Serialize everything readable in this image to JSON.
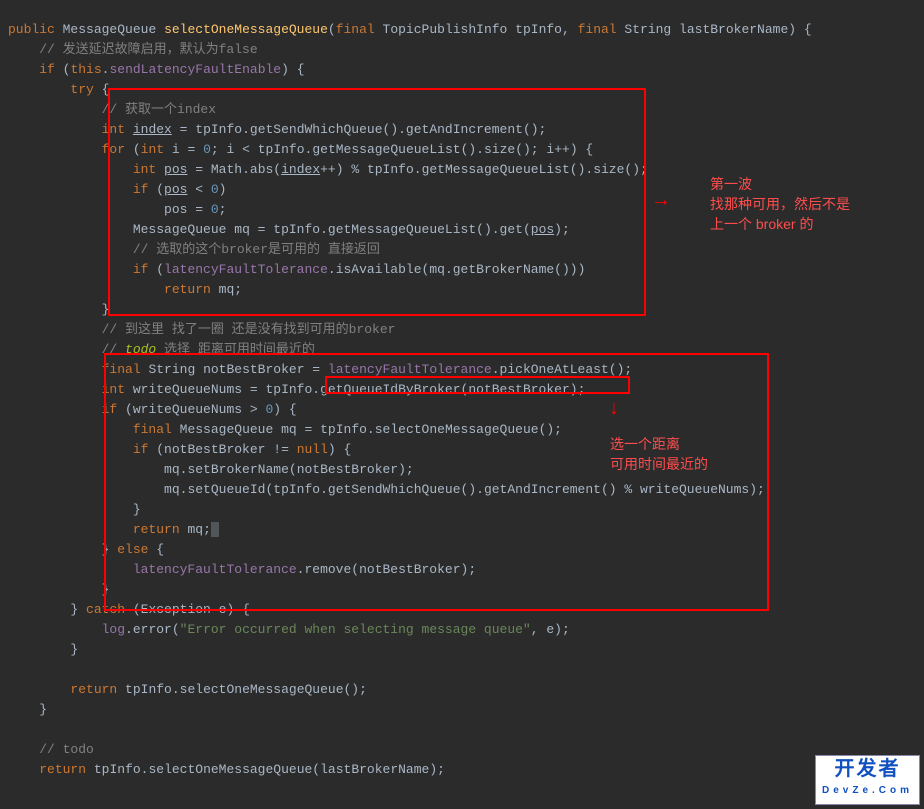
{
  "code": {
    "l0a": "public",
    "l0b": "MessageQueue",
    "l0c": "selectOneMessageQueue",
    "l0d": "final",
    "l0e": "TopicPublishInfo",
    "l0f": "tpInfo",
    "l0g": "final",
    "l0h": "String",
    "l0i": "lastBrokerName",
    "c1": "// 发送延迟故障启用，默认为false",
    "l2a": "if",
    "l2b": "this",
    "l2c": "sendLatencyFaultEnable",
    "l3a": "try",
    "c4": "// 获取一个index",
    "l5a": "int",
    "l5b": "index",
    "l5c": "tpInfo",
    "l5d": "getSendWhichQueue",
    "l5e": "getAndIncrement",
    "l6a": "for",
    "l6b": "int",
    "l6c": "i",
    "l6d": "0",
    "l6e": "i",
    "l6f": "tpInfo",
    "l6g": "getMessageQueueList",
    "l6h": "size",
    "l6i": "i++",
    "l7a": "int",
    "l7b": "pos",
    "l7c": "Math",
    "l7d": "abs",
    "l7e": "index",
    "l7f": "tpInfo",
    "l7g": "getMessageQueueList",
    "l7h": "size",
    "l8a": "if",
    "l8b": "pos",
    "l8c": "0",
    "l9a": "pos",
    "l9b": "0",
    "l10a": "MessageQueue",
    "l10b": "mq",
    "l10c": "tpInfo",
    "l10d": "getMessageQueueList",
    "l10e": "get",
    "l10f": "pos",
    "c11": "// 选取的这个broker是可用的 直接返回",
    "l12a": "if",
    "l12b": "latencyFaultTolerance",
    "l12c": "isAvailable",
    "l12d": "mq",
    "l12e": "getBrokerName",
    "l13a": "return",
    "l13b": "mq",
    "c15": "// 到这里 找了一圈 还是没有找到可用的broker",
    "c16a": "// ",
    "c16b": "todo",
    "c16c": " 选择 距离可用时间最近的",
    "l17a": "final",
    "l17b": "String",
    "l17c": "notBestBroker",
    "l17d": "latencyFaultTolerance",
    "l17e": "pickOneAtLeast",
    "l18a": "int",
    "l18b": "writeQueueNums",
    "l18c": "tpInfo",
    "l18d": "getQueueIdByBroker",
    "l18e": "notBestBroker",
    "l19a": "if",
    "l19b": "writeQueueNums",
    "l19c": "0",
    "l20a": "final",
    "l20b": "MessageQueue",
    "l20c": "mq",
    "l20d": "tpInfo",
    "l20e": "selectOneMessageQueue",
    "l21a": "if",
    "l21b": "notBestBroker",
    "l21c": "null",
    "l22a": "mq",
    "l22b": "setBrokerName",
    "l22c": "notBestBroker",
    "l23a": "mq",
    "l23b": "setQueueId",
    "l23c": "tpInfo",
    "l23d": "getSendWhichQueue",
    "l23e": "getAndIncrement",
    "l23f": "writeQueueNums",
    "l25a": "return",
    "l25b": "mq",
    "l26a": "else",
    "l27a": "latencyFaultTolerance",
    "l27b": "remove",
    "l27c": "notBestBroker",
    "l29a": "catch",
    "l29b": "Exception",
    "l29c": "e",
    "l30a": "log",
    "l30b": "error",
    "l30c": "\"Error occurred when selecting message queue\"",
    "l30d": "e",
    "l32a": "return",
    "l32b": "tpInfo",
    "l32c": "selectOneMessageQueue",
    "c34": "// todo",
    "l35a": "return",
    "l35b": "tpInfo",
    "l35c": "selectOneMessageQueue",
    "l35d": "lastBrokerName"
  },
  "annotations": {
    "a1_l1": "第一波",
    "a1_l2": "找那种可用，然后不是",
    "a1_l3": "上一个 broker 的",
    "a2_l1": "选一个距离",
    "a2_l2": "可用时间最近的"
  },
  "watermark": {
    "main": "开发者",
    "sub": "DevZe.Com"
  }
}
